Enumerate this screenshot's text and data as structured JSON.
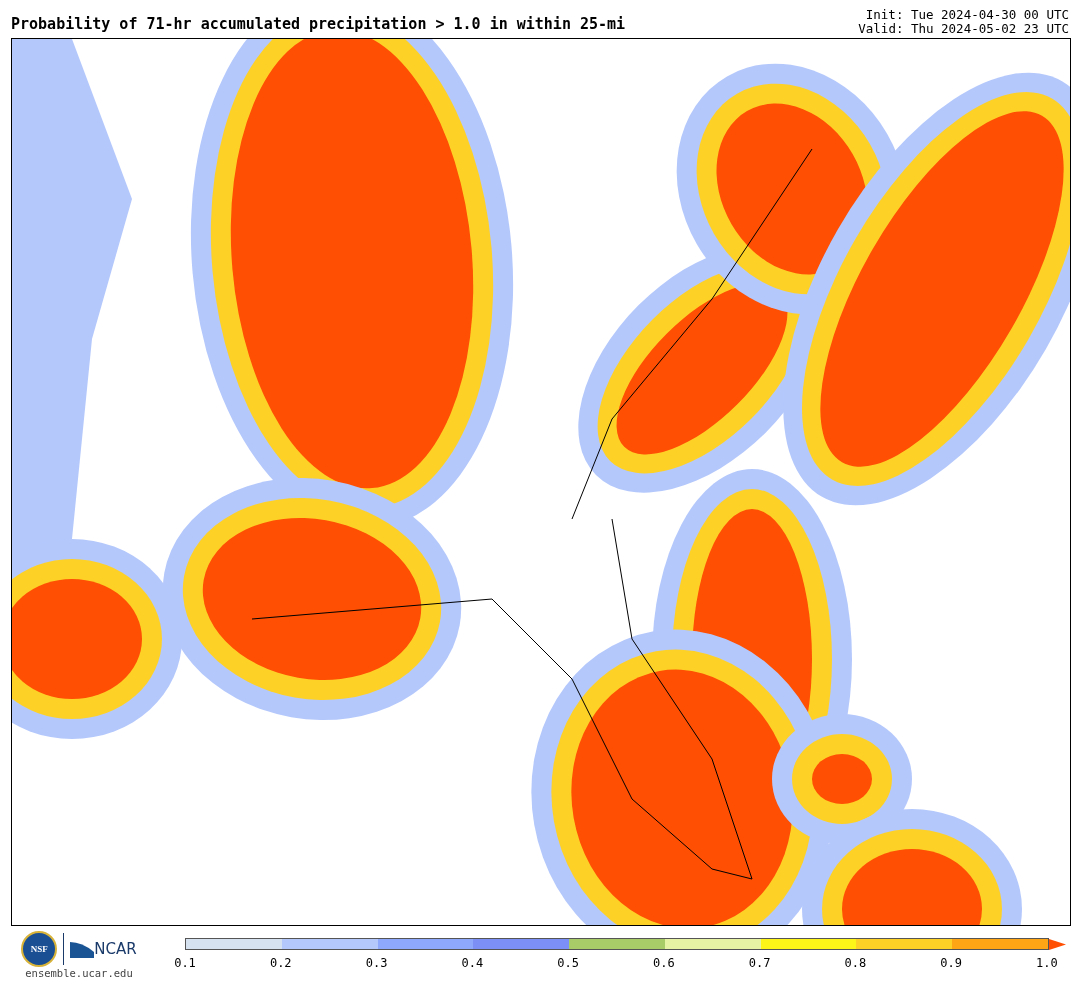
{
  "title": "Probability of 71-hr accumulated precipitation > 1.0 in within 25-mi",
  "init": "Init: Tue 2024-04-30 00 UTC",
  "valid": "Valid: Thu 2024-05-02 23 UTC",
  "logos": {
    "nsf": "NSF",
    "ncar": "NCAR",
    "url": "ensemble.ucar.edu"
  },
  "colorbar": {
    "segments": [
      {
        "color": "#d6e2ef"
      },
      {
        "color": "#b4c8fc"
      },
      {
        "color": "#8ea8fb"
      },
      {
        "color": "#7b8ff7"
      },
      {
        "color": "#a8cd68"
      },
      {
        "color": "#e6f3a4"
      },
      {
        "color": "#fef518"
      },
      {
        "color": "#fed127"
      },
      {
        "color": "#fda514"
      }
    ],
    "arrow": {
      "color": "#fe4f03"
    },
    "ticks": [
      "0.1",
      "0.2",
      "0.3",
      "0.4",
      "0.5",
      "0.6",
      "0.7",
      "0.8",
      "0.9",
      "1.0"
    ]
  }
}
